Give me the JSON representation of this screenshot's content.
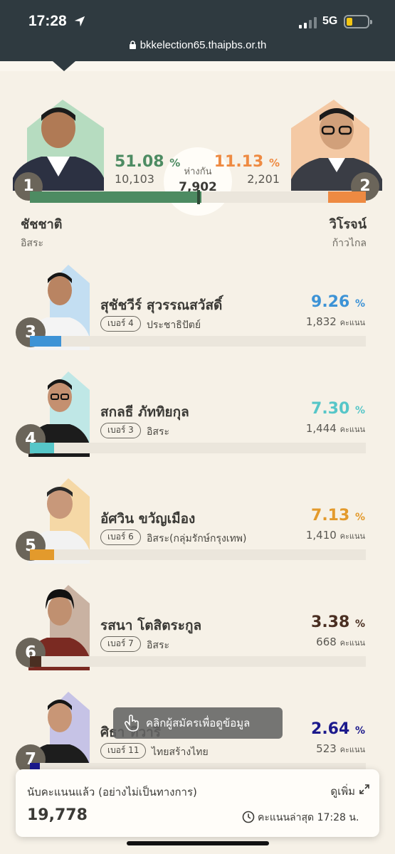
{
  "status": {
    "time": "17:28",
    "network": "5G"
  },
  "browser": {
    "url": "bkkelection65.thaipbs.or.th"
  },
  "head_to_head": {
    "gap_label": "ห่างกัน",
    "gap_value": "7,902",
    "left": {
      "number": "1",
      "name": "ชัชชาติ",
      "party": "อิสระ",
      "percent": "51.08",
      "votes": "10,103",
      "share": 51.08,
      "color": "#4d8b62",
      "shade": "#b6dcc0"
    },
    "right": {
      "number": "2",
      "name": "วิโรจน์",
      "party": "ก้าวไกล",
      "percent": "11.13",
      "votes": "2,201",
      "share": 11.13,
      "color": "#ee8a42",
      "shade": "#f4c9a4"
    }
  },
  "percent_sign": "%",
  "unit_votes": "คะแนน",
  "number_prefix": "เบอร์",
  "candidates": [
    {
      "number": "3",
      "name": "สุชัชวีร์ สุวรรณสวัสดิ์",
      "badge": "เบอร์ 4",
      "party": "ประชาธิปัตย์",
      "percent": "9.26",
      "votes": "1,832",
      "share": 9.26,
      "color": "#3d93d6",
      "shade": "#c3def2"
    },
    {
      "number": "4",
      "name": "สกลธี ภัททิยกุล",
      "badge": "เบอร์ 3",
      "party": "อิสระ",
      "percent": "7.30",
      "votes": "1,444",
      "share": 7.3,
      "color": "#56c6c8",
      "shade": "#bfe7e6"
    },
    {
      "number": "5",
      "name": "อัศวิน ขวัญเมือง",
      "badge": "เบอร์ 6",
      "party": "อิสระ(กลุ่มรักษ์กรุงเทพ)",
      "percent": "7.13",
      "votes": "1,410",
      "share": 7.13,
      "color": "#e39a2c",
      "shade": "#f5d8a6"
    },
    {
      "number": "6",
      "name": "รสนา โตสิตระกูล",
      "badge": "เบอร์ 7",
      "party": "อิสระ",
      "percent": "3.38",
      "votes": "668",
      "share": 3.38,
      "color": "#4a2f22",
      "shade": "#c9b2a2"
    },
    {
      "number": "7",
      "name": "ศิธา ทิวารี",
      "badge": "เบอร์ 11",
      "party": "ไทยสร้างไทย",
      "percent": "2.64",
      "votes": "523",
      "share": 2.64,
      "color": "#1c1a8c",
      "shade": "#c6c3e6"
    }
  ],
  "tooltip": "คลิกผู้สมัครเพื่อดูข้อมูล",
  "summary": {
    "label": "นับคะแนนแล้ว (อย่างไม่เป็นทางการ)",
    "more": "ดูเพิ่ม",
    "total": "19,778",
    "updated": "คะแนนล่าสุด 17:28 น."
  },
  "icons": [
    "location-arrow-icon",
    "signal-icon",
    "battery-icon",
    "lock-icon",
    "hand-pointer-icon",
    "expand-icon",
    "clock-icon"
  ]
}
